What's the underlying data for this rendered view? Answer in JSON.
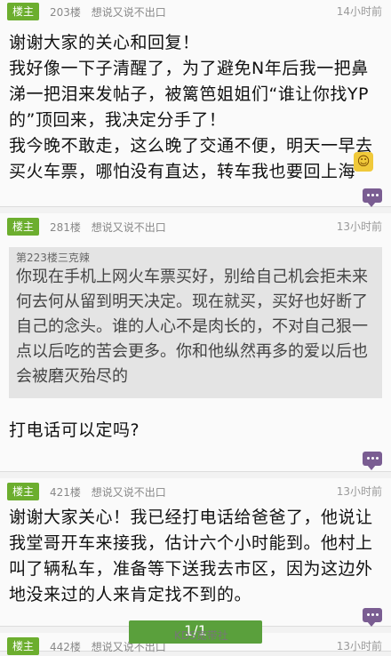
{
  "posts": [
    {
      "badge": "楼主",
      "floor": "203楼",
      "username": "想说又说不出口",
      "time": "14小时前",
      "text": "谢谢大家的关心和回复！\n我好像一下子清醒了，为了避免N年后我一把鼻涕一把泪来发帖子，被篱笆姐姐们“谁让你找YP的”顶回来，我决定分手了！\n我今晚不敢走，这么晚了交通不便，明天一早去买火车票，哪怕没有直达，转车我也要回上海"
    },
    {
      "badge": "楼主",
      "floor": "281楼",
      "username": "想说又说不出口",
      "time": "13小时前",
      "quote_title": "第223楼三克辣",
      "quote_text": "你现在手机上网火车票买好，别给自己机会拒未来何去何从留到明天决定。现在就买，买好也好断了自己的念头。谁的人心不是肉长的，不对自己狠一点以后吃的苦会更多。你和他纵然再多的爱以后也会被磨灭殆尽的",
      "text": "打电话可以定吗?"
    },
    {
      "badge": "楼主",
      "floor": "421楼",
      "username": "想说又说不出口",
      "time": "13小时前",
      "text": "谢谢大家关心！我已经打电话给爸爸了，他说让我堂哥开车来接我，估计六个小时能到。他村上叫了辆私车，准备等下送我去市区，因为这边外地没来过的人来肯定找不到的。"
    },
    {
      "badge": "楼主",
      "floor": "442楼",
      "username": "想说又说不出口",
      "time": "13小时前"
    }
  ],
  "pager": "1/1",
  "watermark": "KDS宽带社",
  "icons": {
    "reply": "reply-bubble-icon",
    "emoji": "emoji-icon"
  },
  "colors": {
    "badge": "#6cae2e",
    "reply_icon": "#7a5d92",
    "pager": "#5aa03c"
  }
}
